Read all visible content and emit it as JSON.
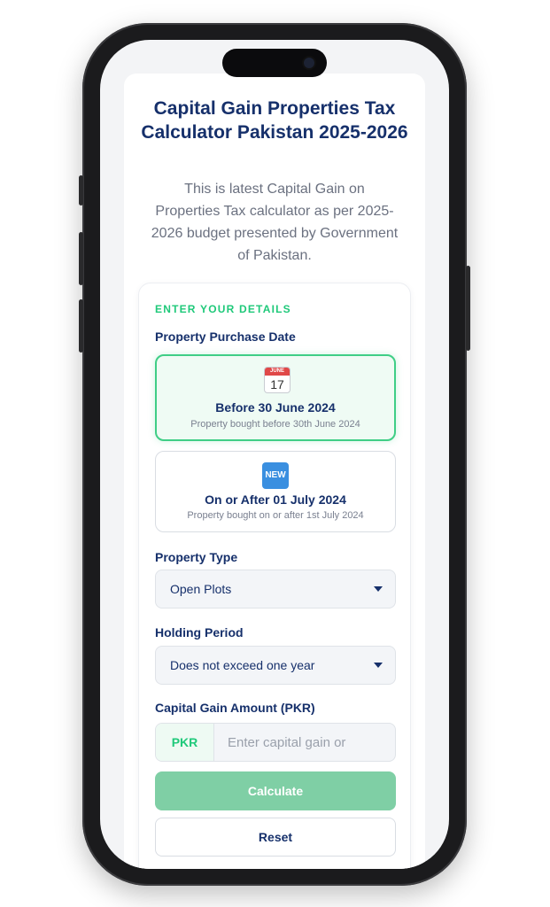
{
  "header": {
    "title": "Capital Gain Properties Tax Calculator Pakistan 2025-2026",
    "subtitle": "This is latest Capital Gain on Properties Tax calculator as per 2025-2026 budget presented by Government of Pakistan."
  },
  "form": {
    "section_heading": "ENTER YOUR DETAILS",
    "purchase_date": {
      "label": "Property Purchase Date",
      "options": [
        {
          "title": "Before 30 June 2024",
          "description": "Property bought before 30th June 2024",
          "icon": "calendar-icon",
          "calendar_month": "JUNE",
          "calendar_day": "17",
          "selected": true
        },
        {
          "title": "On or After 01 July 2024",
          "description": "Property bought on or after 1st July 2024",
          "icon": "new-badge-icon",
          "badge_text": "NEW",
          "selected": false
        }
      ]
    },
    "property_type": {
      "label": "Property Type",
      "value": "Open Plots"
    },
    "holding_period": {
      "label": "Holding Period",
      "value": "Does not exceed one year"
    },
    "capital_gain": {
      "label": "Capital Gain Amount (PKR)",
      "prefix": "PKR",
      "placeholder": "Enter capital gain or",
      "value": ""
    },
    "calculate_label": "Calculate",
    "reset_label": "Reset"
  },
  "colors": {
    "primary_text": "#16306b",
    "accent_green": "#1fc97a",
    "selected_border": "#3fce86",
    "calculate_button": "#7fcfa5",
    "badge_blue": "#3a8fe0"
  }
}
